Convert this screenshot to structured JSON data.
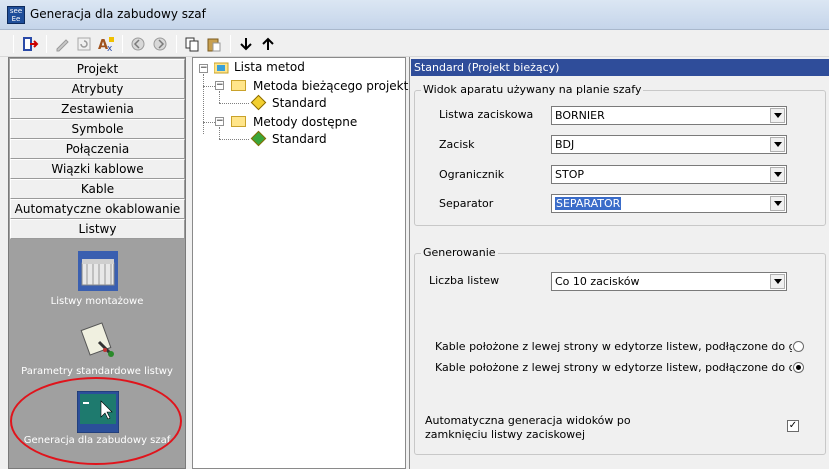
{
  "window": {
    "title": "Generacja dla zabudowy szaf",
    "icon_text": "see Ee"
  },
  "toolbar": {
    "icons": [
      "exit-icon",
      "pencil-icon",
      "refresh-icon",
      "text-style-icon",
      "nav-back-icon",
      "nav-forward-icon",
      "copy-icon",
      "paste-icon",
      "arrow-down-icon",
      "arrow-up-icon"
    ]
  },
  "nav": {
    "items": [
      "Projekt",
      "Atrybuty",
      "Zestawienia",
      "Symbole",
      "Połączenia",
      "Wiązki kablowe",
      "Kable",
      "Automatyczne okablowanie",
      "Listwy"
    ],
    "panel_items": [
      "Listwy montażowe",
      "Parametry standardowe listwy",
      "Generacja dla zabudowy szaf"
    ],
    "highlight_color": "#e0141c"
  },
  "tree": {
    "root": "Lista metod",
    "branches": [
      {
        "label": "Metoda bieżącego projektu",
        "children": [
          "Standard"
        ]
      },
      {
        "label": "Metody dostępne",
        "children": [
          "Standard"
        ]
      }
    ]
  },
  "panel": {
    "header": "Standard (Projekt bieżący)",
    "header_color": "#2f4d9a",
    "group1": {
      "title": "Widok aparatu używany na planie szafy",
      "fields": [
        {
          "label": "Listwa zaciskowa",
          "value": "BORNIER"
        },
        {
          "label": "Zacisk",
          "value": "BDJ"
        },
        {
          "label": "Ogranicznik",
          "value": "STOP"
        },
        {
          "label": "Separator",
          "value": "SEPARATOR"
        }
      ]
    },
    "group2": {
      "title": "Generowanie",
      "count_label": "Liczba listew",
      "count_value": "Co 10 zacisków",
      "radio1": "Kable położone z lewej strony w edytorze listew, podłączone do góry zacis",
      "radio2": "Kable położone z lewej strony w edytorze listew, podłączone do dołu zacis",
      "radio_selected": 2,
      "auto_line1": "Automatyczna generacja widoków po",
      "auto_line2": "zamknięciu listwy zaciskowej",
      "auto_checked": true,
      "check_mark": "✓"
    }
  }
}
